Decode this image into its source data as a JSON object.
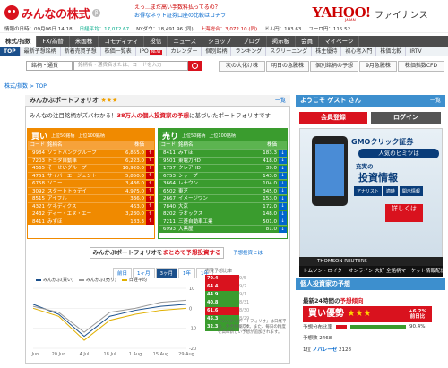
{
  "header": {
    "logo": "みんなの株式",
    "promo_line1": "えっ…まだ高い手数料払ってるの？",
    "promo_line2": "お得なネット証券口座の比較はコチラ",
    "yahoo": "YAHOO!",
    "yahoo_sub": "JAPAN",
    "finance": "ファイナンス"
  },
  "ticker": [
    {
      "label": "情報の日時：09月06日 14:18",
      "dir": ""
    },
    {
      "label": "日経平均：17,072.67",
      "dir": "up"
    },
    {
      "label": "NYダウ：18,491.96 (同)",
      "dir": ""
    },
    {
      "label": "上海総合：3,072.10 (同)",
      "dir": "dn"
    },
    {
      "label": "ドル円：103.63",
      "dir": ""
    },
    {
      "label": "ユーロ円：115.52",
      "dir": ""
    }
  ],
  "nav": [
    "株式/指数",
    "FX/為替",
    "米国株",
    "コモディティ",
    "投信",
    "ニュース",
    "ショップ",
    "ブログ",
    "掲示板",
    "会員",
    "マイページ"
  ],
  "subnav": {
    "top": "TOP",
    "items": [
      "最新予想銘柄",
      "新着売買予想",
      "株価一覧表",
      "IPO",
      "カレンダー",
      "個別銘柄",
      "ランキング",
      "スクリーニング",
      "株主優待",
      "初心者入門",
      "株価比較",
      "IRTV"
    ],
    "new": "NEW"
  },
  "search": {
    "select": "銘柄・通貨",
    "placeholder": "銘柄名・通貨名または、コードを入力"
  },
  "quick_row1": [
    "次の大化け株",
    "明日の急騰株",
    "個別銘柄の予想",
    "9月急騰株",
    "株価指数CFD"
  ],
  "quick_row2": [],
  "breadcrumb": "株式/指数  >  TOP",
  "main": {
    "title": "みんかぶポートフォリオ",
    "more": "一覧",
    "intro_pre": "みんなの注目銘柄がズバわかる！",
    "intro_bold": "38万人の個人投資家の予想",
    "intro_post": "に基づいたポートフォリオです",
    "buy": {
      "title": "買い",
      "opt1": "上位50銘柄",
      "opt2": "上位100銘柄",
      "col_code": "コード",
      "col_name": "銘柄名",
      "col_price": "株価",
      "rows": [
        [
          "9984",
          "ソフトバンクグループ",
          "6,855.0"
        ],
        [
          "7203",
          "トヨタ自動車",
          "6,223.0"
        ],
        [
          "4565",
          "そーせいグループ",
          "16,920.0"
        ],
        [
          "4751",
          "サイバーエージェント",
          "5,850.0"
        ],
        [
          "6758",
          "ソニー",
          "3,436.0"
        ],
        [
          "3092",
          "スタートトゥデイ",
          "4,975.0"
        ],
        [
          "8515",
          "アイフル",
          "336.0"
        ],
        [
          "4321",
          "ケネディクス",
          "463.0"
        ],
        [
          "2432",
          "ディー・エヌ・エー",
          "3,230.0"
        ],
        [
          "8411",
          "みずほ",
          "183.3"
        ]
      ]
    },
    "sell": {
      "title": "売り",
      "opt1": "上位50銘柄",
      "opt2": "上位100銘柄",
      "col_code": "コード",
      "col_name": "銘柄名",
      "col_price": "株価",
      "rows": [
        [
          "8411",
          "みずほ",
          "183.3"
        ],
        [
          "9501",
          "東電力HD",
          "418.0"
        ],
        [
          "1757",
          "クレアHD",
          "39.0"
        ],
        [
          "6753",
          "シャープ",
          "143.0"
        ],
        [
          "3664",
          "レナウン",
          "104.0"
        ],
        [
          "6502",
          "東芝",
          "345.0"
        ],
        [
          "2667",
          "イメージワン",
          "153.0"
        ],
        [
          "7840",
          "大京",
          "172.0"
        ],
        [
          "8202",
          "ラオックス",
          "148.0"
        ],
        [
          "7211",
          "三菱自動車工業",
          "501.0"
        ],
        [
          "6993",
          "大黒屋",
          "81.0"
        ]
      ]
    },
    "big_button_pre": "みんかぶポートフォリオを",
    "big_button_bold": "まとめて予想投資する",
    "howto": "予想投資とは",
    "periods": [
      "前日",
      "1ヶ月",
      "3ヶ月",
      "1年",
      "1年"
    ],
    "period_active": 2,
    "legend": [
      "みんかぶ(買い)",
      "みんかぶ(売り)",
      "日経平均"
    ],
    "rank_header": "売買予想比率",
    "ranks": [
      [
        "70.4",
        "9/5",
        "p"
      ],
      [
        "64.4",
        "9/2",
        "p"
      ],
      [
        "44.9",
        "9/1",
        "n"
      ],
      [
        "40.8",
        "8/31",
        "n"
      ],
      [
        "61.6",
        "8/30",
        "p"
      ],
      [
        "45.3",
        "8/29",
        "n"
      ],
      [
        "32.3",
        "8/26",
        "n"
      ]
    ],
    "note": "「みんかぶポートフォリオ」は日経平均...参考情報です。また、毎日の精度を高め新しい予想が追加されます。",
    "chart_data": {
      "type": "line",
      "x": [
        "6 Jun",
        "20 Jun",
        "4 Jul",
        "18 Jul",
        "1 Aug",
        "15 Aug",
        "29 Aug"
      ],
      "series": [
        {
          "name": "みんかぶ(買い)",
          "values": [
            2,
            -3,
            -14,
            -4,
            -1,
            1,
            2
          ]
        },
        {
          "name": "みんかぶ(売り)",
          "values": [
            1,
            -2,
            -12,
            -2,
            0,
            3,
            4
          ]
        },
        {
          "name": "日経平均",
          "values": [
            0,
            -4,
            -16,
            -6,
            -3,
            -1,
            0
          ]
        }
      ],
      "yticks": [
        10,
        0,
        -10,
        -20
      ]
    }
  },
  "side": {
    "welcome": "ようこそ ゲスト さん",
    "close": "一覧",
    "register": "会員登録",
    "login": "ログイン",
    "ad_brand": "GMOクリック証券",
    "ad_pill": "人気のヒミツは",
    "ad_line": "充実の",
    "ad_big": "投資情報",
    "ad_tags": [
      "アナリスト",
      "適時",
      "開示情報"
    ],
    "ad_badge": "詳しくは",
    "ad_sub": "THOMSON REUTERS",
    "ad_bottom": "トムソン・ロイター オンライン 大好 全銘柄マーケット情報配信サービス",
    "section2": "個人投資家の予想",
    "s2_title_pre": "最新24時間の",
    "s2_title_bold": "予想傾向",
    "s2_title_post": "",
    "buy_strength": "買い優勢",
    "stars": "★★★",
    "pct": "+6.2%",
    "pct_sub": "前日比",
    "ratio_label": "予想分布比率",
    "ratio_val": "90.4%",
    "trade_label": "予想数",
    "trade_val": "2468",
    "rank1": "1位",
    "rank1_name": "ノバレーゼ",
    "rank1_code": "2128"
  }
}
